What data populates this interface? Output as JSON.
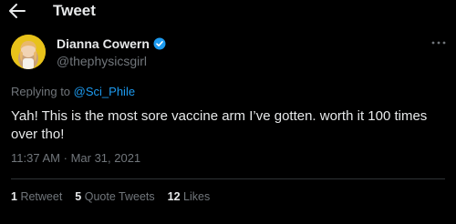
{
  "header": {
    "back_icon": "arrow-left-icon",
    "title": "Tweet"
  },
  "author": {
    "name": "Dianna Cowern",
    "handle": "@thephysicsgirl",
    "verified_icon": "verified-badge-icon",
    "more_icon": "more-horizontal-icon"
  },
  "reply": {
    "prefix": "Replying to",
    "mention": "@Sci_Phile"
  },
  "tweet": {
    "text": "Yah! This is the most sore vaccine arm I’ve gotten. worth it 100 times over tho!"
  },
  "meta": {
    "time": "11:37 AM",
    "separator": "·",
    "date": "Mar 31, 2021"
  },
  "stats": {
    "retweets": {
      "count": "1",
      "label": "Retweet"
    },
    "quotes": {
      "count": "5",
      "label": "Quote Tweets"
    },
    "likes": {
      "count": "12",
      "label": "Likes"
    }
  },
  "colors": {
    "background": "#000000",
    "text": "#e7e9ea",
    "muted": "#71767b",
    "accent": "#1d9bf0",
    "divider": "#2f3336"
  }
}
